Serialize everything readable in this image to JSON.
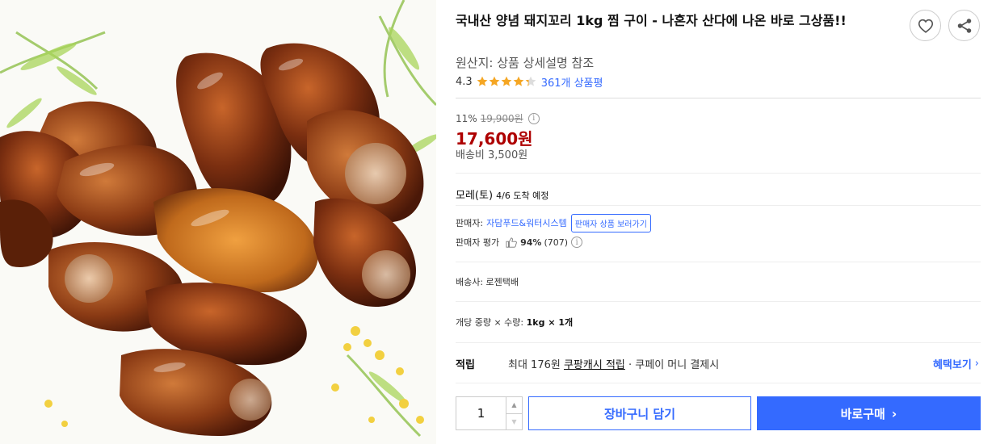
{
  "product": {
    "title": "국내산 양념 돼지꼬리 1kg 찜 구이 - 나혼자 산다에 나온 바로 그상품!!",
    "origin": "원산지: 상품 상세설명 참조",
    "image_alt": "braised pork tail pieces"
  },
  "actions": {
    "wish_icon": "heart-icon",
    "share_icon": "share-icon"
  },
  "rating": {
    "score": "4.3",
    "stars": 4.3,
    "max_stars": 5,
    "review_text": "361개 상품평",
    "star_color": "#f5a623"
  },
  "price": {
    "discount_rate": "11%",
    "original_price": "19,900원",
    "sale_price": "17,600원",
    "shipping_fee": "배송비 3,500원",
    "sale_color": "#ae0000"
  },
  "delivery": {
    "arrival_day": "모레(토)",
    "arrival_detail": "4/6 도착 예정"
  },
  "seller": {
    "label": "판매자:",
    "name": "자담푸드&워터시스템",
    "button_label": "판매자 상품 보러가기",
    "rating_label": "판매자 평가",
    "rating_pct": "94%",
    "rating_count": "(707)"
  },
  "courier": {
    "text": "배송사: 로젠택배"
  },
  "option": {
    "label": "개당 중량 × 수량:",
    "value": "1kg × 1개"
  },
  "reward": {
    "label": "적립",
    "prefix": "최대 176원",
    "link": "쿠팡캐시 적립",
    "suffix": "· 쿠페이 머니 결제시",
    "more": "혜택보기"
  },
  "purchase": {
    "quantity": "1",
    "cart_label": "장바구니 담기",
    "buy_label": "바로구매",
    "accent": "#346aff"
  }
}
